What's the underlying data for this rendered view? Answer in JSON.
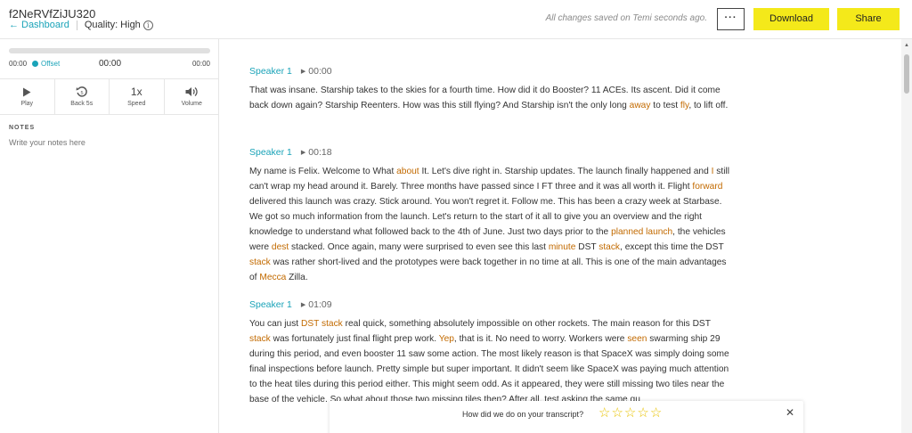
{
  "header": {
    "doc_title": "f2NeRVfZiJU320",
    "dashboard_link": "Dashboard",
    "quality": "Quality: High",
    "save_status": "All changes saved on Temi seconds ago.",
    "more_label": "···",
    "download_label": "Download",
    "share_label": "Share",
    "accent_color": "#f4e91a"
  },
  "player": {
    "start_time": "00:00",
    "offset_label": "Offset",
    "current_time": "00:00",
    "end_time": "00:00",
    "controls": [
      {
        "label": "Play",
        "icon": "play-icon"
      },
      {
        "label": "Back 5s",
        "icon": "rewind-icon"
      },
      {
        "label": "Speed",
        "value": "1x"
      },
      {
        "label": "Volume",
        "icon": "volume-icon"
      }
    ]
  },
  "notes": {
    "label": "NOTES",
    "placeholder": "Write your notes here"
  },
  "transcript": [
    {
      "speaker": "Speaker 1",
      "timestamp": "00:00",
      "text": "That was insane. Starship takes to the skies for a fourth time. How did it do Booster? 11 ACEs. Its ascent. Did it come back down again? Starship Reenters. How was this still flying? And Starship isn't the only long away to test fly, to lift off."
    },
    {
      "speaker": "Speaker 1",
      "timestamp": "00:18",
      "text": "My name is Felix. Welcome to What about It. Let's dive right in. Starship updates. The launch finally happened and I still can't wrap my head around it. Barely. Three months have passed since I FT three and it was all worth it. Flight forward delivered this launch was crazy. Stick around. You won't regret it. Follow me. This has been a crazy week at Starbase. We got so much information from the launch. Let's return to the start of it all to give you an overview and the right knowledge to understand what followed back to the 4th of June. Just two days prior to the planned launch, the vehicles were dest stacked. Once again, many were surprised to even see this last minute DST stack, except this time the DST stack was rather short-lived and the prototypes were back together in no time at all. This is one of the main advantages of Mecca Zilla."
    },
    {
      "speaker": "Speaker 1",
      "timestamp": "01:09",
      "text": "You can just DST stack real quick, something absolutely impossible on other rockets. The main reason for this DST stack was fortunately just final flight prep work. Yep, that is it. No need to worry. Workers were seen swarming ship 29 during this period, and even booster 11 saw some action. The most likely reason is that SpaceX was simply doing some final inspections before launch. Pretty simple but super important. It didn't seem like SpaceX was paying much attention to the heat tiles during this period either. This might seem odd. As it appeared, they were still missing two tiles near the base of the vehicle. So what about those two missing tiles then? After all, test asking the same qu"
    }
  ],
  "low_confidence_color": "#c26a00",
  "rating": {
    "question": "How did we do on your transcript?",
    "star_count": 5,
    "close_label": "✕"
  }
}
